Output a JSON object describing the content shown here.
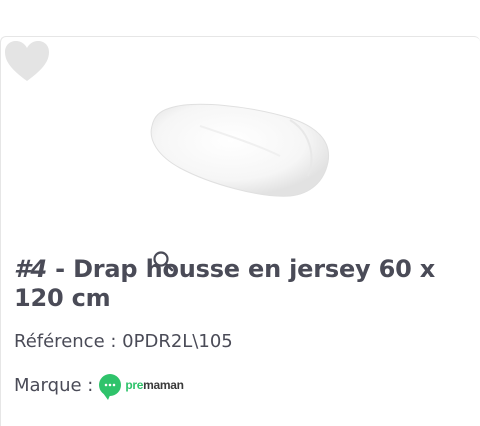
{
  "product": {
    "rank": "#4",
    "separator": " - ",
    "name": "Drap housse en jersey 60 x 120 cm",
    "reference_label": "Référence : ",
    "reference_value": "0PDR2L\\105",
    "brand_label": "Marque : ",
    "brand_logo_text_accent": "pre",
    "brand_logo_text": "maman"
  },
  "icons": {
    "favorite": "heart-icon",
    "zoom": "magnifier-icon",
    "brand": "chat-bubble-logo"
  },
  "colors": {
    "text": "#4a4b57",
    "brand_green": "#2fc36b",
    "heart": "#e4e4e4",
    "border": "#e6e6e6"
  }
}
